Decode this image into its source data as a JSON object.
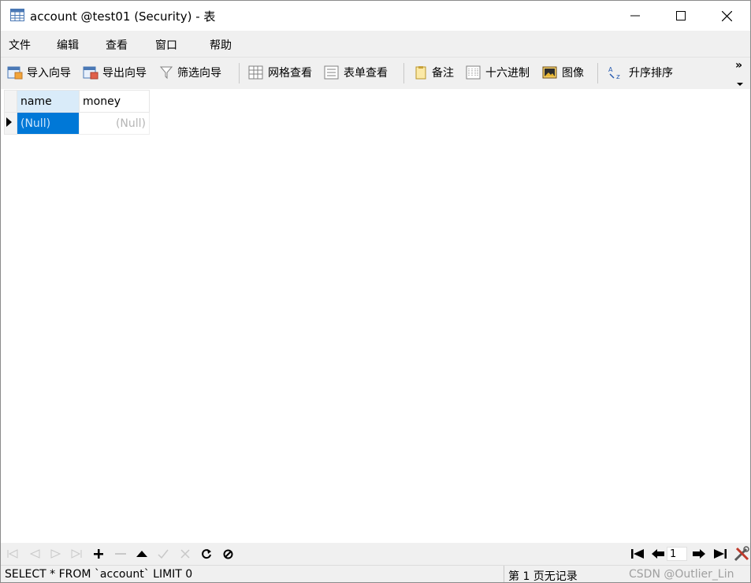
{
  "window": {
    "title": "account @test01 (Security) - 表"
  },
  "menu": [
    "文件",
    "编辑",
    "查看",
    "窗口",
    "帮助"
  ],
  "toolbar": {
    "import_wizard": "导入向导",
    "export_wizard": "导出向导",
    "filter_wizard": "筛选向导",
    "grid_view": "网格查看",
    "form_view": "表单查看",
    "memo": "备注",
    "hex": "十六进制",
    "image": "图像",
    "sort_ascending": "升序排序",
    "more": "»"
  },
  "grid": {
    "columns": [
      "name",
      "money"
    ],
    "rows": [
      {
        "name": "(Null)",
        "money": "(Null)"
      }
    ]
  },
  "navigation": {
    "current_page": "1"
  },
  "status": {
    "sql": "SELECT * FROM `account` LIMIT 0",
    "page_info": "第 1 页无记录",
    "watermark": "CSDN @Outlier_Lin"
  },
  "colors": {
    "selection": "#0078d7",
    "chrome": "#f0f0f0"
  }
}
